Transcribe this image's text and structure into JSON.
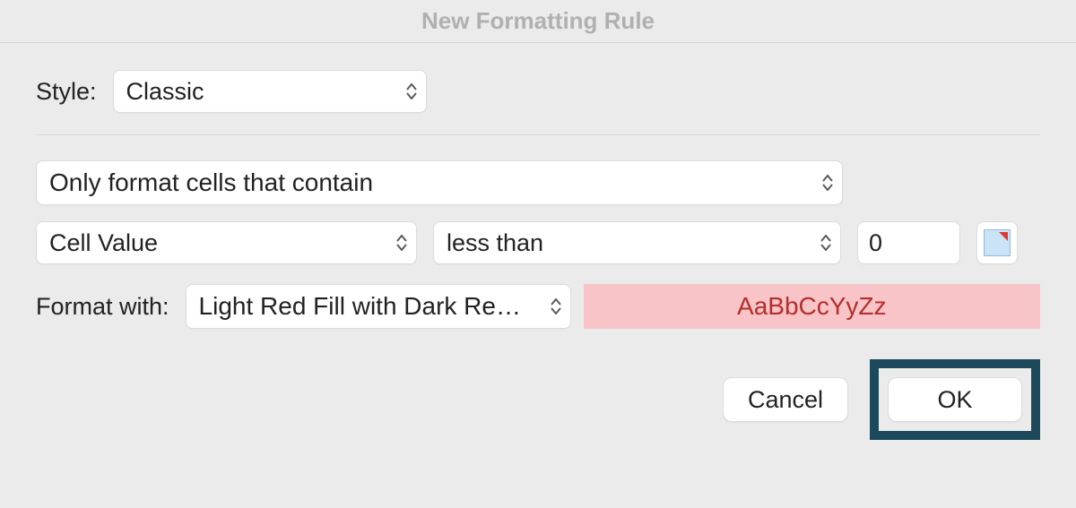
{
  "title": "New Formatting Rule",
  "labels": {
    "style": "Style:",
    "format_with": "Format with:"
  },
  "style_select": {
    "value": "Classic"
  },
  "rule_type_select": {
    "value": "Only format cells that contain"
  },
  "condition": {
    "subject": "Cell Value",
    "operator": "less than",
    "value": "0"
  },
  "format_select": {
    "value": "Light Red Fill with Dark Red T..."
  },
  "preview": {
    "sample_text": "AaBbCcYyZz"
  },
  "buttons": {
    "cancel": "Cancel",
    "ok": "OK"
  }
}
